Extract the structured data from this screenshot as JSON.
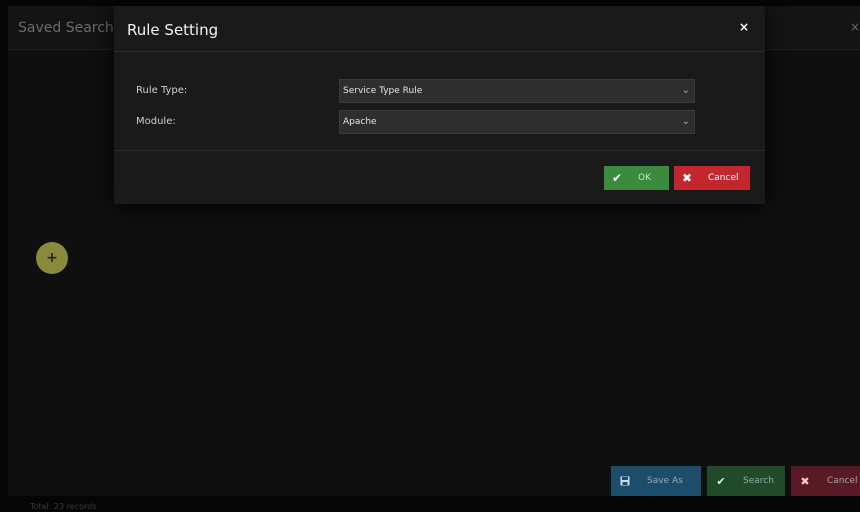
{
  "background_dialog": {
    "title": "Saved Search R",
    "close_symbol": "×",
    "add_symbol": "+",
    "footer": {
      "save_as_label": "Save As",
      "search_label": "Search",
      "cancel_label": "Cancel"
    },
    "bottom_text": "Total: 23 records"
  },
  "modal": {
    "title": "Rule Setting",
    "close_symbol": "×",
    "fields": [
      {
        "label": "Rule Type:",
        "value": "Service Type Rule"
      },
      {
        "label": "Module:",
        "value": "Apache"
      }
    ],
    "ok_label": "OK",
    "cancel_label": "Cancel"
  },
  "icons": {
    "check": "check-icon",
    "close": "close-icon",
    "save": "save-icon",
    "chevron": "chevron-down-icon"
  },
  "colors": {
    "ok": "#3b8b3e",
    "cancel": "#c1272d",
    "save_as": "#1c4d6a",
    "add_button": "#8b8a3c"
  }
}
